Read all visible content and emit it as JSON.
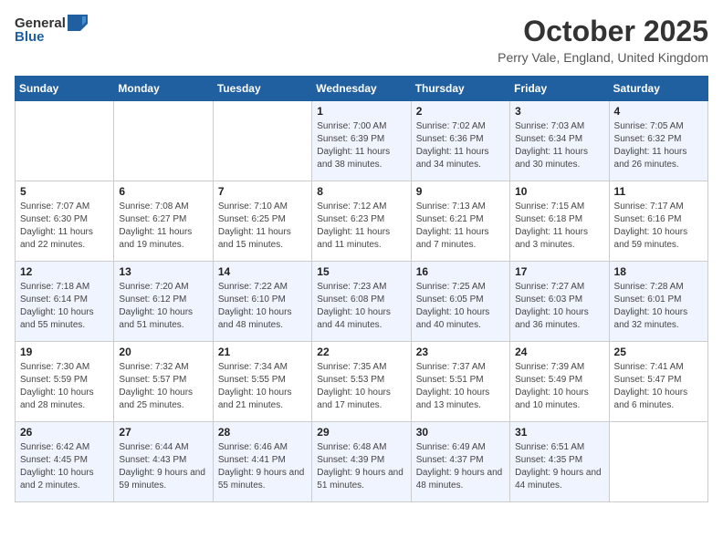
{
  "header": {
    "logo_general": "General",
    "logo_blue": "Blue",
    "month_title": "October 2025",
    "location": "Perry Vale, England, United Kingdom"
  },
  "weekdays": [
    "Sunday",
    "Monday",
    "Tuesday",
    "Wednesday",
    "Thursday",
    "Friday",
    "Saturday"
  ],
  "weeks": [
    [
      {
        "day": "",
        "sunrise": "",
        "sunset": "",
        "daylight": ""
      },
      {
        "day": "",
        "sunrise": "",
        "sunset": "",
        "daylight": ""
      },
      {
        "day": "",
        "sunrise": "",
        "sunset": "",
        "daylight": ""
      },
      {
        "day": "1",
        "sunrise": "Sunrise: 7:00 AM",
        "sunset": "Sunset: 6:39 PM",
        "daylight": "Daylight: 11 hours and 38 minutes."
      },
      {
        "day": "2",
        "sunrise": "Sunrise: 7:02 AM",
        "sunset": "Sunset: 6:36 PM",
        "daylight": "Daylight: 11 hours and 34 minutes."
      },
      {
        "day": "3",
        "sunrise": "Sunrise: 7:03 AM",
        "sunset": "Sunset: 6:34 PM",
        "daylight": "Daylight: 11 hours and 30 minutes."
      },
      {
        "day": "4",
        "sunrise": "Sunrise: 7:05 AM",
        "sunset": "Sunset: 6:32 PM",
        "daylight": "Daylight: 11 hours and 26 minutes."
      }
    ],
    [
      {
        "day": "5",
        "sunrise": "Sunrise: 7:07 AM",
        "sunset": "Sunset: 6:30 PM",
        "daylight": "Daylight: 11 hours and 22 minutes."
      },
      {
        "day": "6",
        "sunrise": "Sunrise: 7:08 AM",
        "sunset": "Sunset: 6:27 PM",
        "daylight": "Daylight: 11 hours and 19 minutes."
      },
      {
        "day": "7",
        "sunrise": "Sunrise: 7:10 AM",
        "sunset": "Sunset: 6:25 PM",
        "daylight": "Daylight: 11 hours and 15 minutes."
      },
      {
        "day": "8",
        "sunrise": "Sunrise: 7:12 AM",
        "sunset": "Sunset: 6:23 PM",
        "daylight": "Daylight: 11 hours and 11 minutes."
      },
      {
        "day": "9",
        "sunrise": "Sunrise: 7:13 AM",
        "sunset": "Sunset: 6:21 PM",
        "daylight": "Daylight: 11 hours and 7 minutes."
      },
      {
        "day": "10",
        "sunrise": "Sunrise: 7:15 AM",
        "sunset": "Sunset: 6:18 PM",
        "daylight": "Daylight: 11 hours and 3 minutes."
      },
      {
        "day": "11",
        "sunrise": "Sunrise: 7:17 AM",
        "sunset": "Sunset: 6:16 PM",
        "daylight": "Daylight: 10 hours and 59 minutes."
      }
    ],
    [
      {
        "day": "12",
        "sunrise": "Sunrise: 7:18 AM",
        "sunset": "Sunset: 6:14 PM",
        "daylight": "Daylight: 10 hours and 55 minutes."
      },
      {
        "day": "13",
        "sunrise": "Sunrise: 7:20 AM",
        "sunset": "Sunset: 6:12 PM",
        "daylight": "Daylight: 10 hours and 51 minutes."
      },
      {
        "day": "14",
        "sunrise": "Sunrise: 7:22 AM",
        "sunset": "Sunset: 6:10 PM",
        "daylight": "Daylight: 10 hours and 48 minutes."
      },
      {
        "day": "15",
        "sunrise": "Sunrise: 7:23 AM",
        "sunset": "Sunset: 6:08 PM",
        "daylight": "Daylight: 10 hours and 44 minutes."
      },
      {
        "day": "16",
        "sunrise": "Sunrise: 7:25 AM",
        "sunset": "Sunset: 6:05 PM",
        "daylight": "Daylight: 10 hours and 40 minutes."
      },
      {
        "day": "17",
        "sunrise": "Sunrise: 7:27 AM",
        "sunset": "Sunset: 6:03 PM",
        "daylight": "Daylight: 10 hours and 36 minutes."
      },
      {
        "day": "18",
        "sunrise": "Sunrise: 7:28 AM",
        "sunset": "Sunset: 6:01 PM",
        "daylight": "Daylight: 10 hours and 32 minutes."
      }
    ],
    [
      {
        "day": "19",
        "sunrise": "Sunrise: 7:30 AM",
        "sunset": "Sunset: 5:59 PM",
        "daylight": "Daylight: 10 hours and 28 minutes."
      },
      {
        "day": "20",
        "sunrise": "Sunrise: 7:32 AM",
        "sunset": "Sunset: 5:57 PM",
        "daylight": "Daylight: 10 hours and 25 minutes."
      },
      {
        "day": "21",
        "sunrise": "Sunrise: 7:34 AM",
        "sunset": "Sunset: 5:55 PM",
        "daylight": "Daylight: 10 hours and 21 minutes."
      },
      {
        "day": "22",
        "sunrise": "Sunrise: 7:35 AM",
        "sunset": "Sunset: 5:53 PM",
        "daylight": "Daylight: 10 hours and 17 minutes."
      },
      {
        "day": "23",
        "sunrise": "Sunrise: 7:37 AM",
        "sunset": "Sunset: 5:51 PM",
        "daylight": "Daylight: 10 hours and 13 minutes."
      },
      {
        "day": "24",
        "sunrise": "Sunrise: 7:39 AM",
        "sunset": "Sunset: 5:49 PM",
        "daylight": "Daylight: 10 hours and 10 minutes."
      },
      {
        "day": "25",
        "sunrise": "Sunrise: 7:41 AM",
        "sunset": "Sunset: 5:47 PM",
        "daylight": "Daylight: 10 hours and 6 minutes."
      }
    ],
    [
      {
        "day": "26",
        "sunrise": "Sunrise: 6:42 AM",
        "sunset": "Sunset: 4:45 PM",
        "daylight": "Daylight: 10 hours and 2 minutes."
      },
      {
        "day": "27",
        "sunrise": "Sunrise: 6:44 AM",
        "sunset": "Sunset: 4:43 PM",
        "daylight": "Daylight: 9 hours and 59 minutes."
      },
      {
        "day": "28",
        "sunrise": "Sunrise: 6:46 AM",
        "sunset": "Sunset: 4:41 PM",
        "daylight": "Daylight: 9 hours and 55 minutes."
      },
      {
        "day": "29",
        "sunrise": "Sunrise: 6:48 AM",
        "sunset": "Sunset: 4:39 PM",
        "daylight": "Daylight: 9 hours and 51 minutes."
      },
      {
        "day": "30",
        "sunrise": "Sunrise: 6:49 AM",
        "sunset": "Sunset: 4:37 PM",
        "daylight": "Daylight: 9 hours and 48 minutes."
      },
      {
        "day": "31",
        "sunrise": "Sunrise: 6:51 AM",
        "sunset": "Sunset: 4:35 PM",
        "daylight": "Daylight: 9 hours and 44 minutes."
      },
      {
        "day": "",
        "sunrise": "",
        "sunset": "",
        "daylight": ""
      }
    ]
  ]
}
